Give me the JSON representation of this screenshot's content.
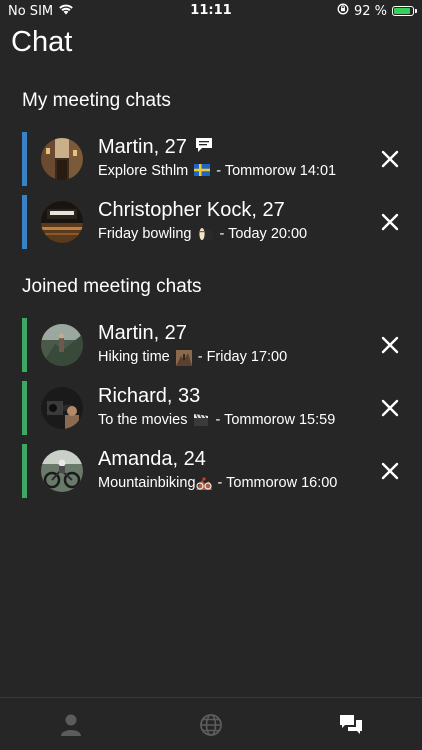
{
  "status_bar": {
    "carrier": "No SIM",
    "time": "11:11",
    "battery_percent": "92 %",
    "battery_level": 0.92
  },
  "page": {
    "title": "Chat"
  },
  "sections": {
    "my_meetings": {
      "title": "My meeting chats",
      "accent_color": "#3b82c4",
      "items": [
        {
          "name": "Martin, 27",
          "activity": "Explore Sthlm",
          "emoji_icon": "sweden-flag-emoji",
          "when": "- Tommorow 14:01",
          "has_message_icon": true
        },
        {
          "name": "Christopher Kock, 27",
          "activity": "Friday bowling",
          "emoji_icon": "bowling-emoji",
          "when": "- Today 20:00",
          "has_message_icon": false
        }
      ]
    },
    "joined_meetings": {
      "title": "Joined meeting chats",
      "accent_color": "#3ea862",
      "items": [
        {
          "name": "Martin, 27",
          "activity": "Hiking time",
          "emoji_icon": "hiking-emoji",
          "when": "- Friday 17:00"
        },
        {
          "name": "Richard, 33",
          "activity": "To the movies",
          "emoji_icon": "clapper-board-emoji",
          "when": "- Tommorow 15:59"
        },
        {
          "name": "Amanda, 24",
          "activity": "Mountainbiking",
          "emoji_icon": "mountain-bike-emoji",
          "when": "- Tommorow 16:00"
        }
      ]
    }
  },
  "tab_bar": {
    "tabs": [
      {
        "icon": "profile-icon",
        "active": false
      },
      {
        "icon": "globe-icon",
        "active": false
      },
      {
        "icon": "chat-bubbles-icon",
        "active": true
      }
    ]
  }
}
